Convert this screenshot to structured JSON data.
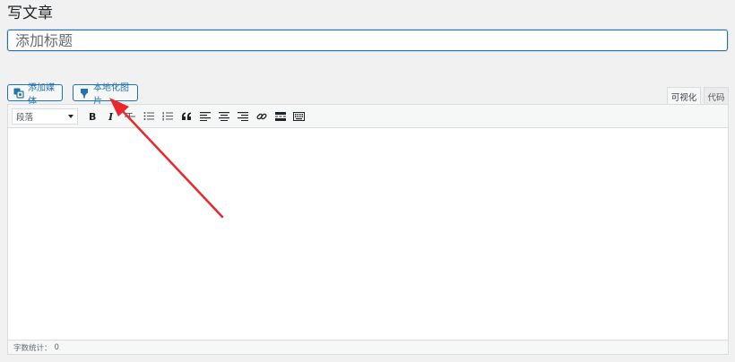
{
  "page": {
    "title": "写文章"
  },
  "title_field": {
    "placeholder": "添加标题",
    "value": ""
  },
  "media_buttons": {
    "add_media": {
      "label": "添加媒体",
      "icon": "media-icon"
    },
    "localize_images": {
      "label": "本地化图片",
      "icon": "download-pin-icon"
    }
  },
  "mode_tabs": {
    "visual": "可视化",
    "code": "代码",
    "active": "visual"
  },
  "toolbar": {
    "format_select": "段落",
    "buttons": [
      "bold",
      "italic",
      "strikethrough",
      "bullet-list",
      "numbered-list",
      "blockquote",
      "align-left",
      "align-center",
      "align-right",
      "link",
      "read-more",
      "toolbar-toggle"
    ]
  },
  "statusbar": {
    "word_count_label": "字数统计：",
    "word_count": "0"
  },
  "colors": {
    "accent": "#2271b1",
    "annotation_arrow": "#e8282b",
    "page_bg": "#f1f1f1"
  }
}
